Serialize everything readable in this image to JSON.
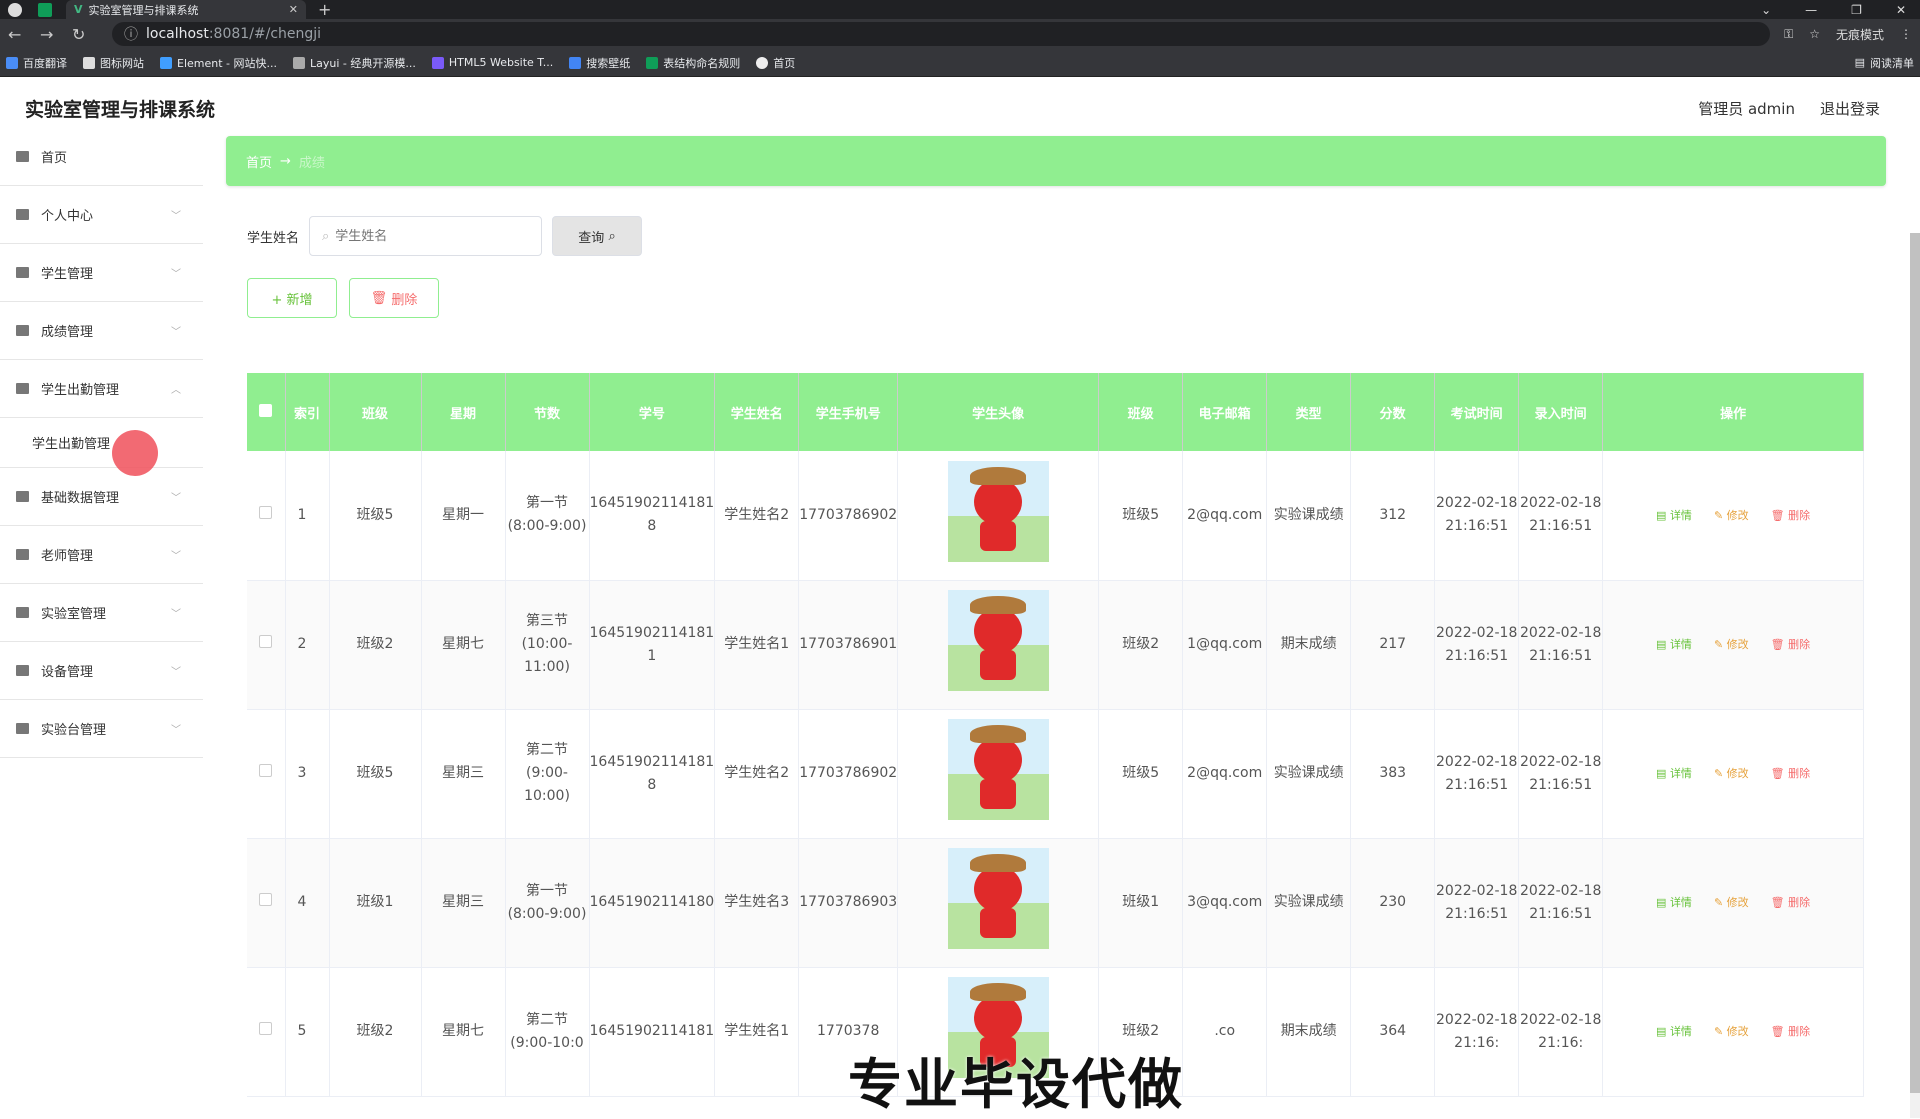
{
  "browser": {
    "tab_title": "实验室管理与排课系统",
    "url_host": "localhost",
    "url_path": ":8081/#/chengji",
    "incognito": "无痕模式",
    "bookmarks": [
      "百度翻译",
      "图标网站",
      "Element - 网站快...",
      "Layui - 经典开源模...",
      "HTML5 Website T...",
      "搜索壁纸",
      "表结构命名规则",
      "首页"
    ],
    "reading_list": "阅读清单"
  },
  "header": {
    "title": "实验室管理与排课系统",
    "user": "管理员 admin",
    "logout": "退出登录"
  },
  "sidebar": {
    "items": [
      {
        "label": "首页",
        "icon": "home-icon"
      },
      {
        "label": "个人中心",
        "icon": "user-icon"
      },
      {
        "label": "学生管理",
        "icon": "student-icon"
      },
      {
        "label": "成绩管理",
        "icon": "grade-icon"
      },
      {
        "label": "学生出勤管理",
        "icon": "attendance-icon"
      },
      {
        "label": "基础数据管理",
        "icon": "data-icon"
      },
      {
        "label": "老师管理",
        "icon": "teacher-icon"
      },
      {
        "label": "实验室管理",
        "icon": "lab-icon"
      },
      {
        "label": "设备管理",
        "icon": "device-icon"
      },
      {
        "label": "实验台管理",
        "icon": "bench-icon"
      }
    ],
    "submenu_label": "学生出勤管理"
  },
  "breadcrumb": {
    "home": "首页",
    "arrow": "→",
    "current": "成绩"
  },
  "search": {
    "label": "学生姓名",
    "placeholder": "学生姓名",
    "button": "查询"
  },
  "actions": {
    "add": "+ 新增",
    "delete": "删除"
  },
  "table": {
    "headers": [
      "索引",
      "班级",
      "星期",
      "节数",
      "学号",
      "学生姓名",
      "学生手机号",
      "学生头像",
      "班级",
      "电子邮箱",
      "类型",
      "分数",
      "考试时间",
      "录入时间",
      "操作"
    ],
    "ops": {
      "detail": "详情",
      "edit": "修改",
      "del": "删除"
    },
    "rows": [
      {
        "idx": "1",
        "cls": "班级5",
        "week": "星期一",
        "section": "第一节(8:00-9:00)",
        "sno": "16451902114181 8",
        "name": "学生姓名2",
        "phone": "17703786902",
        "cls2": "班级5",
        "email": "2@qq.com",
        "type": "实验课成绩",
        "score": "312",
        "exam": "2022-02-18 21:16:51",
        "entry": "2022-02-18 21:16:51"
      },
      {
        "idx": "2",
        "cls": "班级2",
        "week": "星期七",
        "section": "第三节(10:00-11:00)",
        "sno": "16451902114181 1",
        "name": "学生姓名1",
        "phone": "17703786901",
        "cls2": "班级2",
        "email": "1@qq.com",
        "type": "期末成绩",
        "score": "217",
        "exam": "2022-02-18 21:16:51",
        "entry": "2022-02-18 21:16:51"
      },
      {
        "idx": "3",
        "cls": "班级5",
        "week": "星期三",
        "section": "第二节(9:00-10:00)",
        "sno": "16451902114181 8",
        "name": "学生姓名2",
        "phone": "17703786902",
        "cls2": "班级5",
        "email": "2@qq.com",
        "type": "实验课成绩",
        "score": "383",
        "exam": "2022-02-18 21:16:51",
        "entry": "2022-02-18 21:16:51"
      },
      {
        "idx": "4",
        "cls": "班级1",
        "week": "星期三",
        "section": "第一节(8:00-9:00)",
        "sno": "16451902114180",
        "name": "学生姓名3",
        "phone": "17703786903",
        "cls2": "班级1",
        "email": "3@qq.com",
        "type": "实验课成绩",
        "score": "230",
        "exam": "2022-02-18 21:16:51",
        "entry": "2022-02-18 21:16:51"
      },
      {
        "idx": "5",
        "cls": "班级2",
        "week": "星期七",
        "section": "第二节(9:00-10:0",
        "sno": "16451902114181",
        "name": "学生姓名1",
        "phone": "1770378",
        "cls2": "班级2",
        "email": ".co",
        "type": "期末成绩",
        "score": "364",
        "exam": "2022-02-18 21:16:",
        "entry": "2022-02-18 21:16:"
      }
    ]
  },
  "watermark": "专业毕设代做"
}
